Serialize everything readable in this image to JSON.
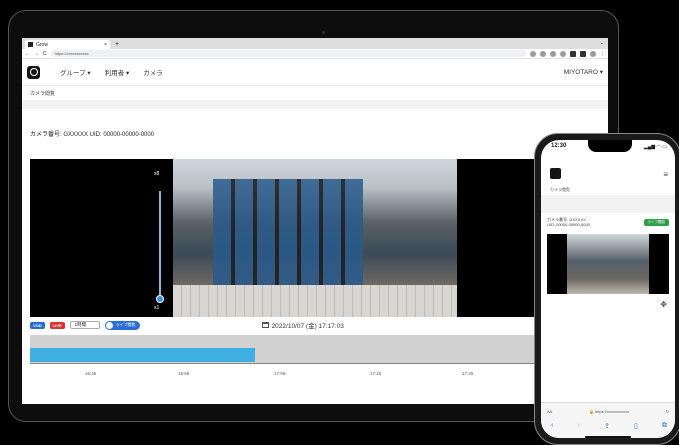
{
  "browser": {
    "tab_title": "Grow",
    "tab_close": "×",
    "new_tab": "+",
    "chevron": "⌄",
    "url": "https://xxxxxxxxxxx"
  },
  "nav": {
    "items": [
      "グループ ▾",
      "利用者 ▾",
      "カメラ"
    ],
    "user": "MIYOTARO ▾"
  },
  "breadcrumb": "カメラ閲覧",
  "camera": {
    "title": "カメラ番号: GXXXXX  UID: 00000-00000-0000",
    "zoom_max": "x8",
    "zoom_min": "x1"
  },
  "controls": {
    "vod": "VOD",
    "live": "LIVE",
    "interval": "1時間",
    "toggle_label": "ライブ閲覧",
    "datetime": "2022/10/07 (金) 17:17:03"
  },
  "timeline": {
    "progress": 0.39,
    "ticks": [
      "16:45",
      "16:55",
      "17:05",
      "17:15",
      "17:25"
    ]
  },
  "phone": {
    "time": "12:30",
    "status": "▂▄▆ ◠ ▭",
    "breadcrumb": "カメラ閲覧",
    "cam_line1": "カメラ番号: GXXXXX",
    "cam_line2": "UID: 00000-00000-0000",
    "button": "ライブ閲覧",
    "aa": "AA",
    "url": "🔒 https://xxxxxxxxxxx",
    "reload": "↻"
  }
}
